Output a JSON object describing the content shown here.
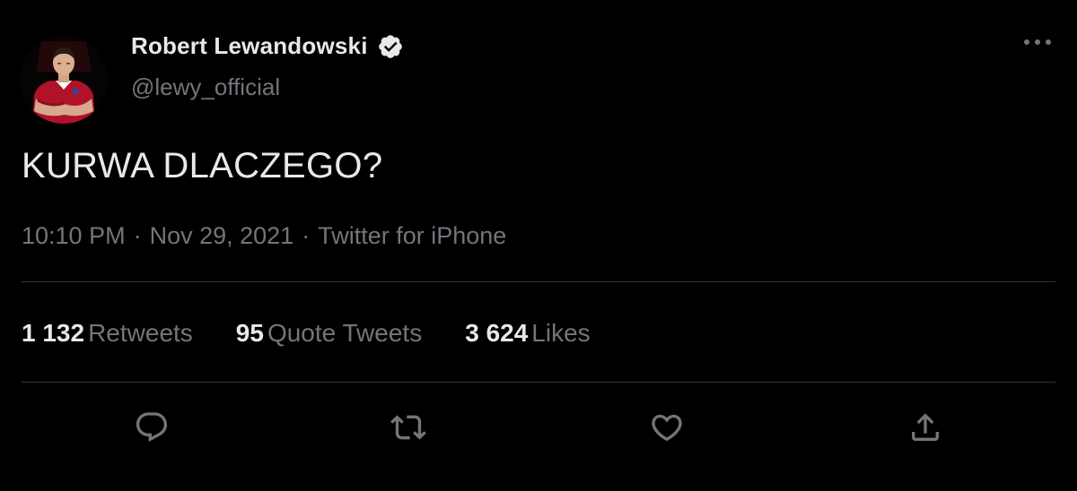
{
  "author": {
    "display_name": "Robert Lewandowski",
    "handle": "@lewy_official",
    "verified": true,
    "avatar_icon": "player-avatar"
  },
  "tweet": {
    "text": "KURWA DLACZEGO?",
    "time": "10:10 PM",
    "date": "Nov 29, 2021",
    "source": "Twitter for iPhone",
    "separator": "·"
  },
  "stats": [
    {
      "count": "1 132",
      "label": "Retweets"
    },
    {
      "count": "95",
      "label": "Quote Tweets"
    },
    {
      "count": "3 624",
      "label": "Likes"
    }
  ],
  "actions": [
    {
      "icon": "reply-icon"
    },
    {
      "icon": "retweet-icon"
    },
    {
      "icon": "like-icon"
    },
    {
      "icon": "share-icon"
    }
  ],
  "colors": {
    "background": "#000000",
    "primary_text": "#e7e9ea",
    "secondary_text": "#71767b",
    "divider": "#2f3336",
    "jersey_red": "#b0122a"
  }
}
